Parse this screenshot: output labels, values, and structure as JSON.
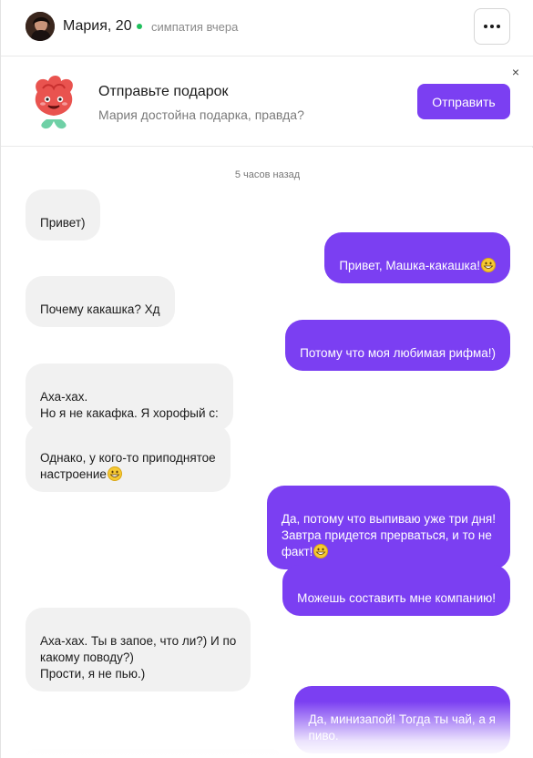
{
  "header": {
    "name": "Мария, 20",
    "status": "симпатия вчера",
    "online_color": "#1fbf5c",
    "more_icon": "more-horizontal-icon"
  },
  "gift_banner": {
    "title": "Отправьте подарок",
    "subtitle": "Мария достойна подарка, правда?",
    "button_label": "Отправить",
    "close_label": "×",
    "mascot_icon": "rose-mascot-icon"
  },
  "chat": {
    "timestamp": "5 часов назад",
    "messages": [
      {
        "side": "incoming",
        "text": "Привет)"
      },
      {
        "side": "outgoing",
        "text": "Привет, Машка-какашка!",
        "emoji": "grinning-face"
      },
      {
        "side": "incoming",
        "text": "Почему какашка? Хд"
      },
      {
        "side": "outgoing",
        "text": "Потому что моя любимая рифма!)"
      },
      {
        "side": "incoming",
        "text": "Аха-хах.\nНо я не какафка. Я хорофый с:"
      },
      {
        "side": "incoming",
        "text": "Однако, у кого-то приподнятое\nнастроение",
        "emoji": "grinning-face"
      },
      {
        "side": "outgoing",
        "text": "Да, потому что выпиваю уже три дня!\nЗавтра придется прерваться, и то не\nфакт!",
        "emoji": "grinning-face"
      },
      {
        "side": "outgoing",
        "text": "Можешь составить мне компанию!"
      },
      {
        "side": "incoming",
        "text": "Аха-хах. Ты в запое, что ли?) И по\nкакому поводу?)\nПрости, я не пью.)"
      },
      {
        "side": "outgoing",
        "text": "Да, минизапой! Тогда ты чай, а я\nпиво."
      }
    ]
  },
  "colors": {
    "accent": "#7b3ff2",
    "incoming_bubble": "#f1f1f1",
    "text_muted": "#8a8a8a"
  }
}
